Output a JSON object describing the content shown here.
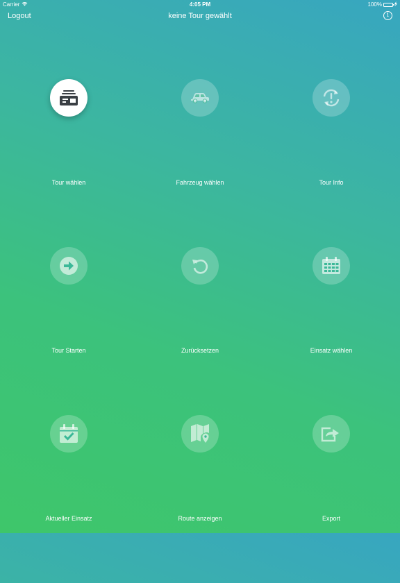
{
  "status_bar": {
    "carrier": "Carrier",
    "time": "4:05 PM",
    "battery": "100%"
  },
  "navbar": {
    "logout_label": "Logout",
    "title": "keine Tour gewählt",
    "info_glyph": "i"
  },
  "tiles": [
    {
      "label": "Tour wählen",
      "icon": "tour-list-icon",
      "active": true
    },
    {
      "label": "Fahrzeug wählen",
      "icon": "car-icon",
      "active": false
    },
    {
      "label": "Tour Info",
      "icon": "sync-alert-icon",
      "active": false
    },
    {
      "label": "Tour Starten",
      "icon": "arrow-right-circle-icon",
      "active": false
    },
    {
      "label": "Zurücksetzen",
      "icon": "reset-icon",
      "active": false
    },
    {
      "label": "Einsatz wählen",
      "icon": "calendar-icon",
      "active": false
    },
    {
      "label": "Aktueller Einsatz",
      "icon": "calendar-check-icon",
      "active": false
    },
    {
      "label": "Route anzeigen",
      "icon": "map-pin-icon",
      "active": false
    },
    {
      "label": "Export",
      "icon": "export-icon",
      "active": false
    }
  ],
  "colors": {
    "gradient_top": "#38a6c0",
    "gradient_bottom": "#3ec66a",
    "active_icon": "#3a3f44",
    "battery_fill": "#4cd964"
  }
}
